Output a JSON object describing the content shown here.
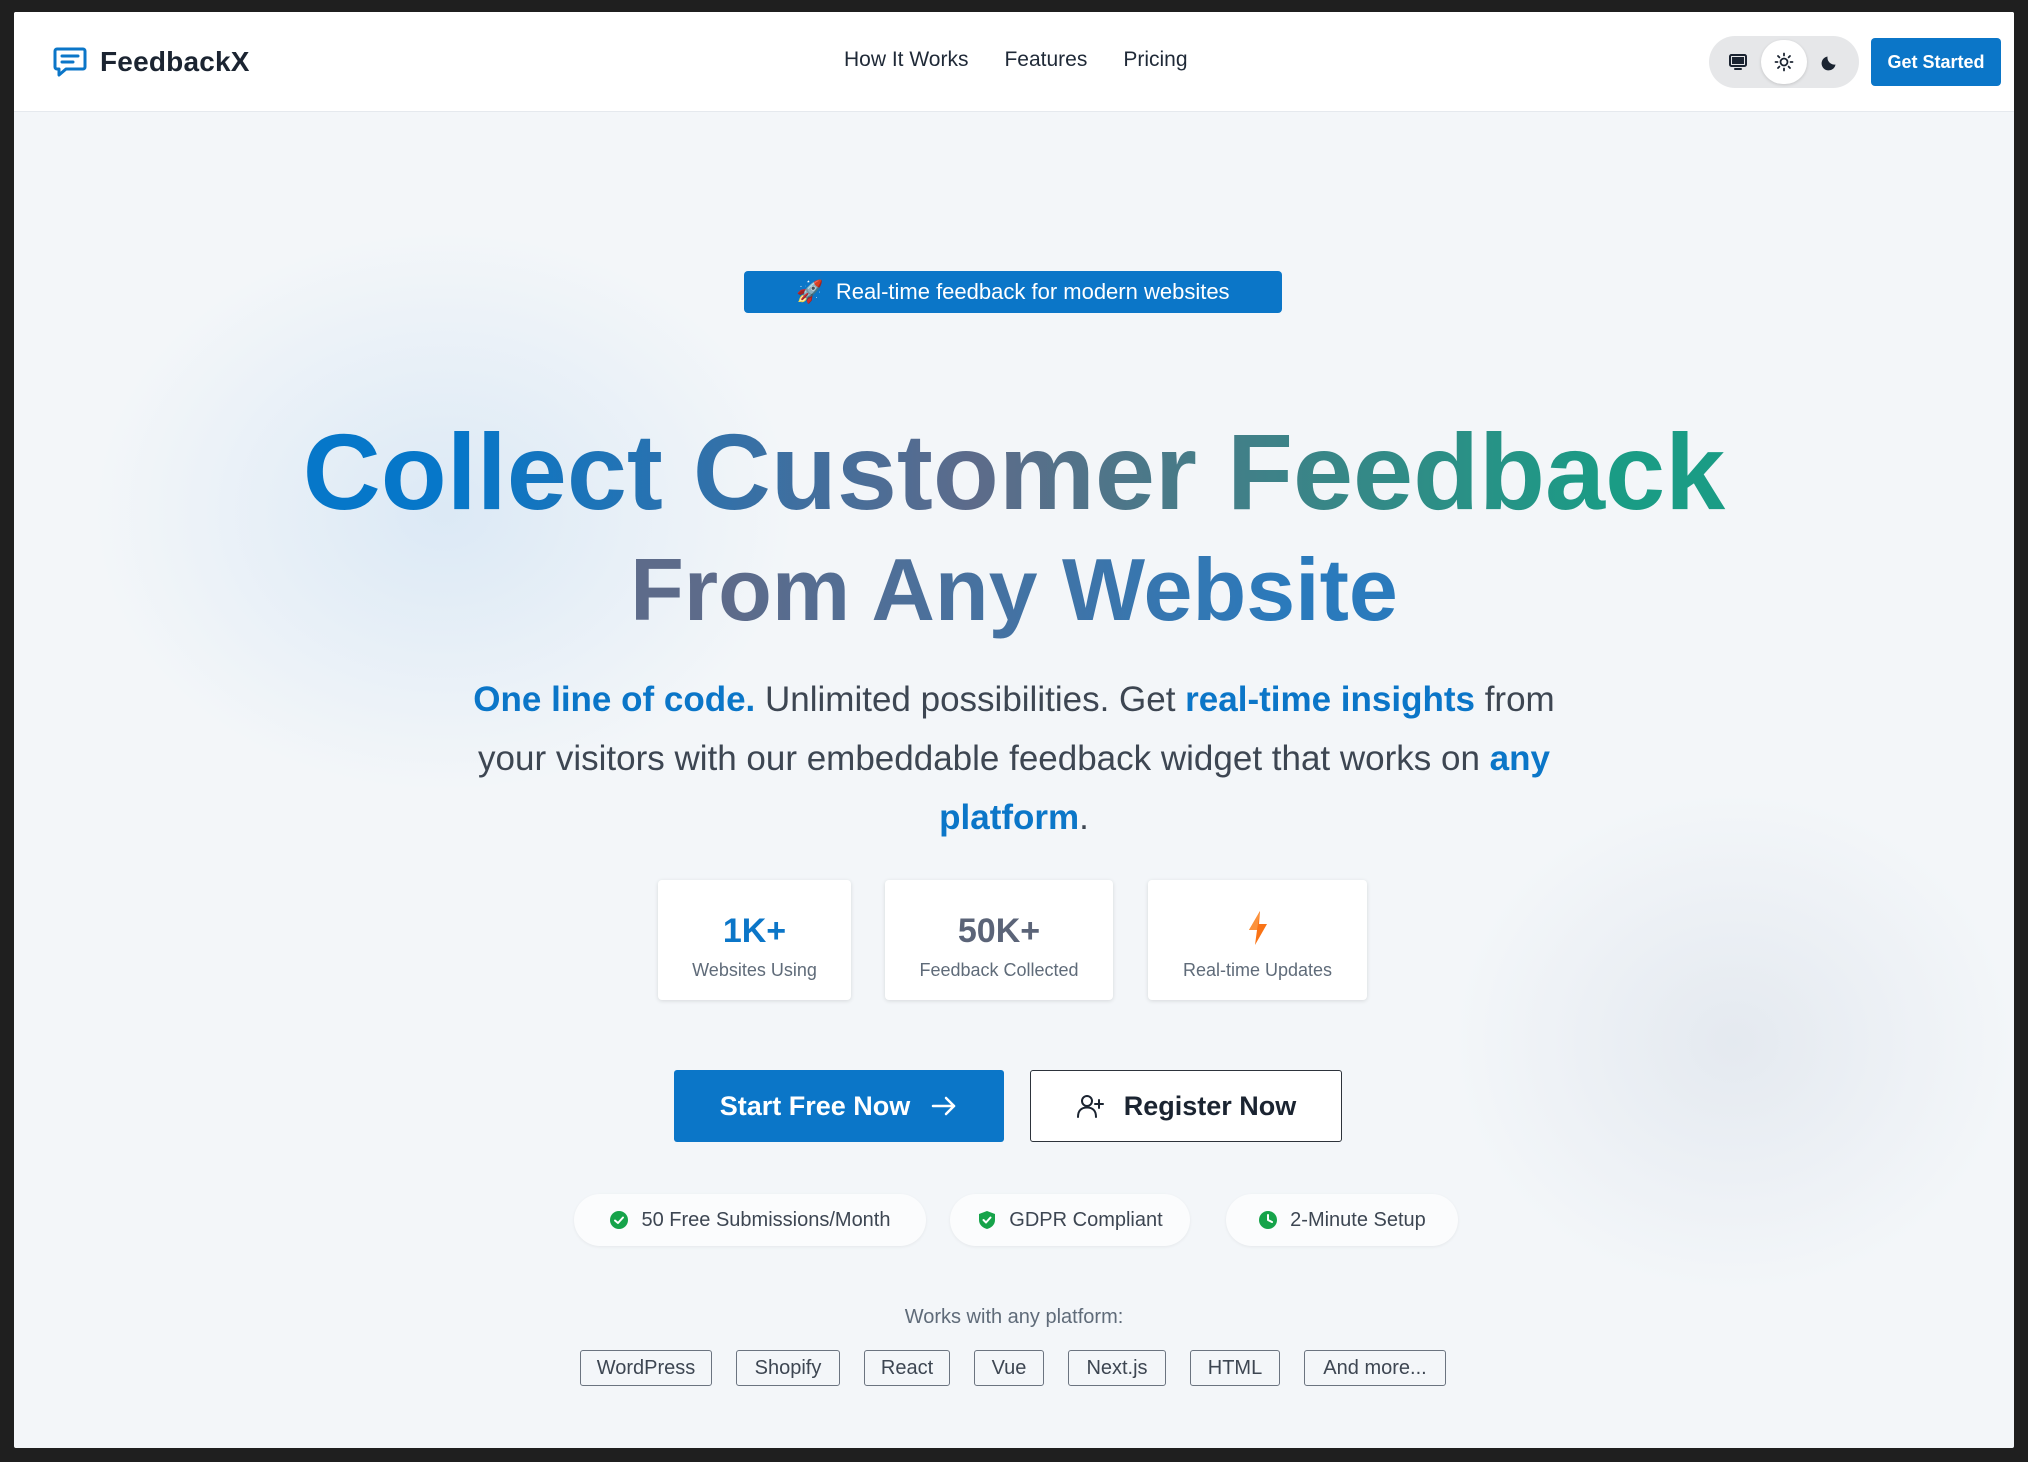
{
  "brand": {
    "name": "FeedbackX",
    "icon": "chat-bubble-icon"
  },
  "nav": {
    "links": [
      "How It Works",
      "Features",
      "Pricing"
    ]
  },
  "theme": {
    "options": [
      "monitor-icon",
      "sun-icon",
      "moon-icon"
    ],
    "active": "sun-icon"
  },
  "header": {
    "cta_label": "Get Started"
  },
  "hero": {
    "badge": {
      "icon": "🚀",
      "text": "Real-time feedback for modern websites"
    },
    "headline_line1": "Collect Customer Feedback",
    "headline_line2": "From Any Website",
    "subtitle": {
      "part1": "One line of code.",
      "part2": " Unlimited possibilities. Get ",
      "part3": "real-time insights",
      "part4": " from your visitors with our embeddable feedback widget that works on ",
      "part5": "any platform",
      "part6": "."
    },
    "stats": [
      {
        "value": "1K+",
        "label": "Websites Using"
      },
      {
        "value": "50K+",
        "label": "Feedback Collected"
      },
      {
        "icon": "lightning-bolt-icon",
        "label": "Real-time Updates"
      }
    ],
    "primary_cta": "Start Free Now",
    "secondary_cta": "Register Now",
    "features": [
      {
        "icon": "check-circle-icon",
        "label": "50 Free Submissions/Month"
      },
      {
        "icon": "shield-check-icon",
        "label": "GDPR Compliant"
      },
      {
        "icon": "clock-icon",
        "label": "2-Minute Setup"
      }
    ],
    "platforms_caption": "Works with any platform:",
    "platforms": [
      "WordPress",
      "Shopify",
      "React",
      "Vue",
      "Next.js",
      "HTML",
      "And more..."
    ]
  },
  "colors": {
    "accent": "#0b76c8",
    "teal": "#1a9c85",
    "success": "#16a34a",
    "bolt": "#f97316"
  }
}
